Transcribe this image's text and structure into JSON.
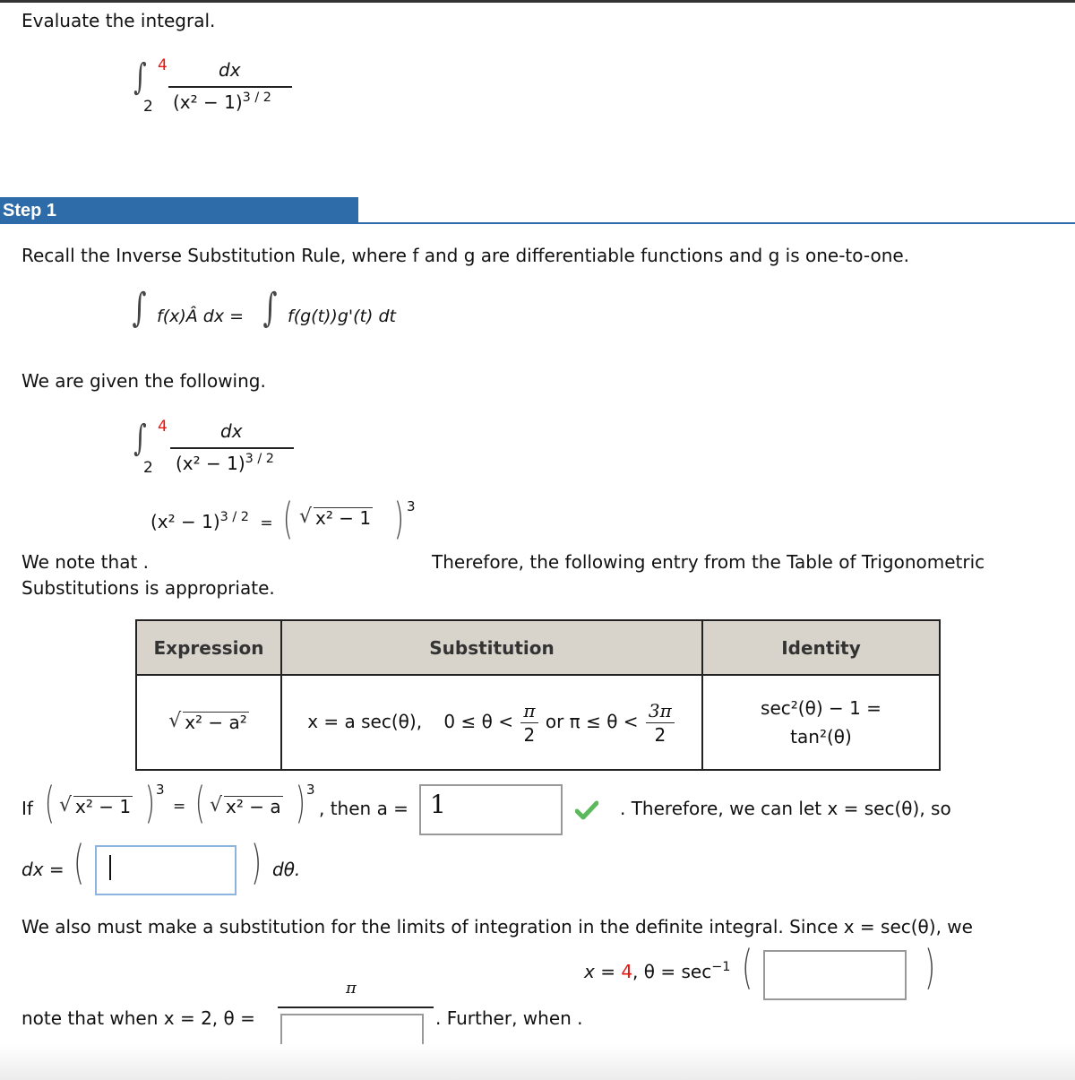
{
  "problem": {
    "prompt": "Evaluate the integral.",
    "integral": {
      "upper_limit": "4",
      "lower_limit": "2",
      "numerator": "dx",
      "denominator": "(x² − 1)",
      "exponent": "3 / 2"
    }
  },
  "step": {
    "label": "Step 1",
    "accent_color": "#2e6ca9",
    "intro": "Recall the Inverse Substitution Rule, where f and g are differentiable functions and g is one-to-one.",
    "rule_lhs": "f(x)Â dx =",
    "rule_rhs": "f(g(t))g'(t) dt",
    "given_text": "We are given the following.",
    "identity_lhs": "(x² − 1)",
    "identity_lhs_exp": "3 / 2",
    "identity_eq": "=",
    "identity_rad": "x² − 1",
    "identity_rhs_exp": "3",
    "note_left": "We note that .",
    "note_left_2": "Substitutions is appropriate.",
    "note_right": "Therefore, the following entry from the Table of Trigonometric"
  },
  "table": {
    "headers": [
      "Expression",
      "Substitution",
      "Identity"
    ],
    "row": {
      "expression": "x² − a²",
      "substitution_prefix": "x = a sec(θ),",
      "range_1": "0 ≤ θ <",
      "frac1_num": "π",
      "frac1_den": "2",
      "or": "or π ≤ θ <",
      "frac2_num": "3π",
      "frac2_den": "2",
      "identity_line1": "sec²(θ) − 1 =",
      "identity_line2": "tan²(θ)"
    }
  },
  "question_a": {
    "if": "If",
    "rad1": "x² − 1",
    "exp": "3",
    "eq": "=",
    "rad2": "x² − a",
    "then": ", then a =",
    "answer": "1",
    "status": "correct",
    "check_color": "#5cb85c",
    "after": ". Therefore, we can let x = sec(θ), so"
  },
  "question_dx": {
    "lhs": "dx =",
    "value": "",
    "suffix": "dθ."
  },
  "limits": {
    "text": "We also must make a substitution for the limits of integration in the definite integral. Since x = sec(θ), we",
    "upper_prefix_x": "x = ",
    "upper_x_value": "4",
    "upper_theta": ", θ = sec",
    "upper_exp": "−1",
    "upper_value": "",
    "lower_text": "note that when x = 2, θ =",
    "lower_numerator": "π",
    "lower_denominator_value": "",
    "further": ". Further, when ."
  }
}
